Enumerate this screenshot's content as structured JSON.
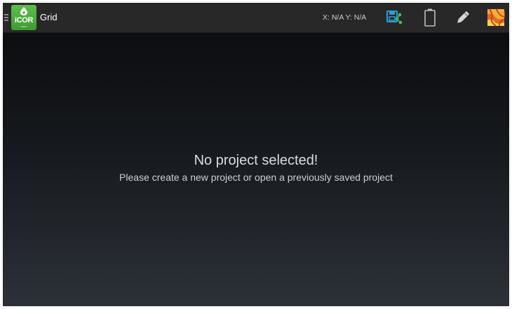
{
  "app": {
    "logo_text": "iCOR",
    "logo_subtext": "GNSS",
    "title": "Grid"
  },
  "actionbar": {
    "coords_text": "X: N/A Y: N/A",
    "icons": [
      "drawer-menu-icon",
      "save-share-icon",
      "battery-icon",
      "pen-icon",
      "map-layers-icon"
    ]
  },
  "main": {
    "heading": "No project selected!",
    "subheading": "Please create a new project or open a previously saved project"
  },
  "colors": {
    "actionbar_bg": "#282828",
    "logo_green": "#4caf3e",
    "icon_green": "#3fbf5a",
    "icon_blue": "#2a9fd8",
    "map_orange": "#e8a020"
  }
}
